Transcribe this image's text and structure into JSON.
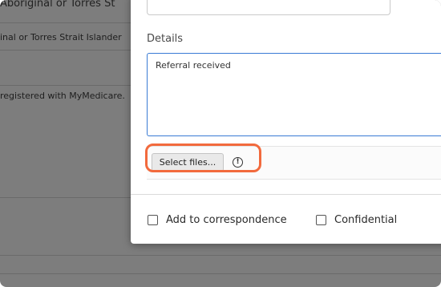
{
  "background": {
    "header_partial": "Aboriginal or Torres St",
    "row_1_partial": "inal or Torres Strait Islander",
    "row_2_partial": "registered with MyMedicare."
  },
  "modal": {
    "details_label": "Details",
    "details_value": "Referral received",
    "select_files_label": "Select files...",
    "info_icon_glyph": "!",
    "add_to_correspondence_label": "Add to correspondence",
    "confidential_label": "Confidential"
  },
  "colors": {
    "overlay_gray": "#7d7d7d",
    "focus_blue": "#3a7bd5",
    "highlight_orange": "#f26a3d"
  }
}
